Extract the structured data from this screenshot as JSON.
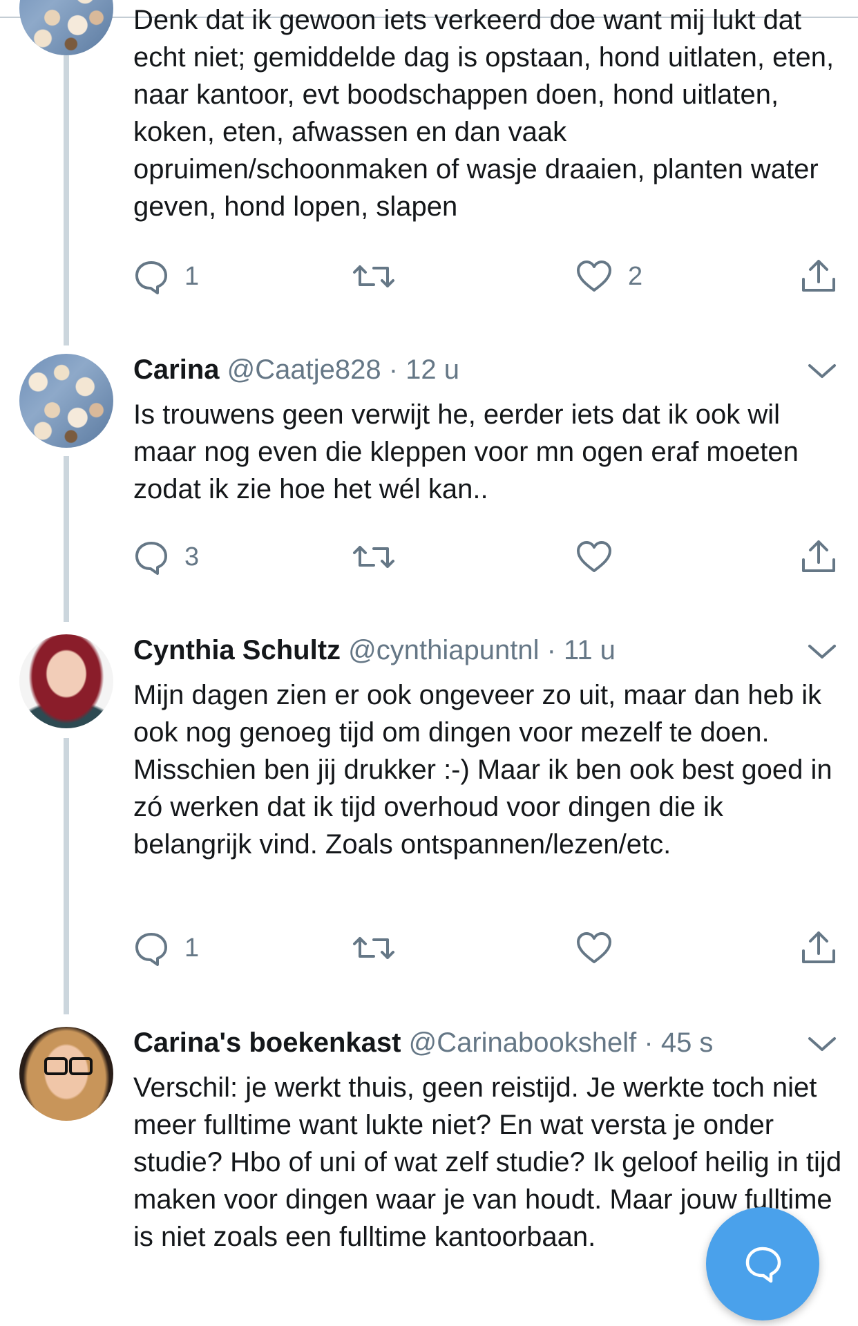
{
  "tweets": [
    {
      "name": "",
      "handle": "",
      "time": "",
      "text": "Denk dat ik gewoon iets verkeerd doe want mij lukt dat echt niet; gemiddelde dag is opstaan, hond uitlaten, eten, naar kantoor, evt boodschappen doen, hond uitlaten, koken, eten, afwassen en dan vaak opruimen/schoonmaken of wasje draaien, planten water geven, hond lopen, slapen",
      "reply_count": "1",
      "retweet_count": "",
      "like_count": "2"
    },
    {
      "name": "Carina",
      "handle": "@Caatje828",
      "time": "· 12 u",
      "text": "Is trouwens geen verwijt he, eerder iets dat ik ook wil maar nog even die kleppen voor mn ogen eraf moeten zodat ik zie hoe het wél kan..",
      "reply_count": "3",
      "retweet_count": "",
      "like_count": ""
    },
    {
      "name": "Cynthia Schultz",
      "handle": "@cynthiapuntnl",
      "time": "· 11 u",
      "text": "Mijn dagen zien er ook ongeveer zo uit, maar dan heb ik ook nog genoeg tijd om dingen voor mezelf te doen. Misschien ben jij drukker :-) Maar ik ben ook best goed in zó werken dat ik tijd overhoud voor dingen die ik belangrijk vind. Zoals ontspannen/lezen/etc.",
      "reply_count": "1",
      "retweet_count": "",
      "like_count": ""
    },
    {
      "name": "Carina's boekenkast",
      "handle": "@Carinabookshelf",
      "time": "· 45 s",
      "text": "Verschil: je werkt thuis, geen reistijd. Je werkte toch niet meer fulltime want lukte niet? En wat versta je onder studie? Hbo of uni of wat zelf studie? Ik geloof heilig in tijd maken voor dingen waar je van houdt. Maar jouw fulltime is niet zoals een fulltime kantoorbaan."
    }
  ],
  "icons": {
    "reply": "reply-icon",
    "retweet": "retweet-icon",
    "like": "heart-icon",
    "share": "share-icon",
    "more": "chevron-down-icon",
    "compose": "compose-reply-icon"
  },
  "colors": {
    "text": "#14171a",
    "muted": "#657786",
    "thread_line": "#ccd6dd",
    "accent": "#4aa1eb"
  }
}
